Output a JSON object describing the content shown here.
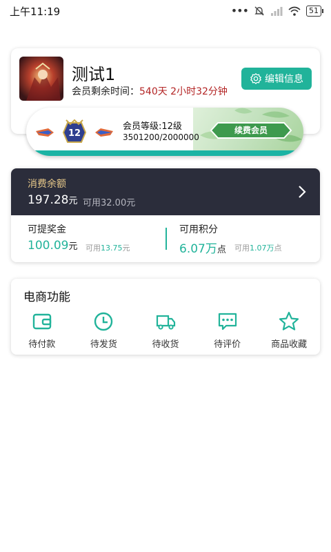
{
  "status_bar": {
    "time": "上午11:19",
    "more": "•••",
    "battery": "51"
  },
  "profile": {
    "name": "测试1",
    "expire_label": "会员剩余时间：",
    "expire_value": "540天 2小时32分钟",
    "edit_button": "编辑信息",
    "level_label": "会员等级:12级",
    "level_progress": "3501200/2000000",
    "level_badge": "12",
    "renew_button": "续费会员"
  },
  "balance": {
    "label": "消费余额",
    "amount": "197.28",
    "amount_unit": "元",
    "available": "可用32.00元"
  },
  "bonus": {
    "label": "可提奖金",
    "value": "100.09",
    "unit": "元",
    "avail_prefix": "可用",
    "avail_value": "13.75",
    "avail_unit": "元"
  },
  "points": {
    "label": "可用积分",
    "value": "6.07万",
    "unit": "点",
    "avail_prefix": "可用",
    "avail_value": "1.07万",
    "avail_unit": "点"
  },
  "shop": {
    "title": "电商功能",
    "items": [
      {
        "label": "待付款",
        "icon": "wallet-icon"
      },
      {
        "label": "待发货",
        "icon": "clock-icon"
      },
      {
        "label": "待收货",
        "icon": "truck-icon"
      },
      {
        "label": "待评价",
        "icon": "chat-icon"
      },
      {
        "label": "商品收藏",
        "icon": "star-icon"
      }
    ]
  },
  "colors": {
    "accent": "#21b39a",
    "dark_panel": "#2b2d3b",
    "gold_label": "#e8c98a",
    "expire_red": "#b32424"
  }
}
